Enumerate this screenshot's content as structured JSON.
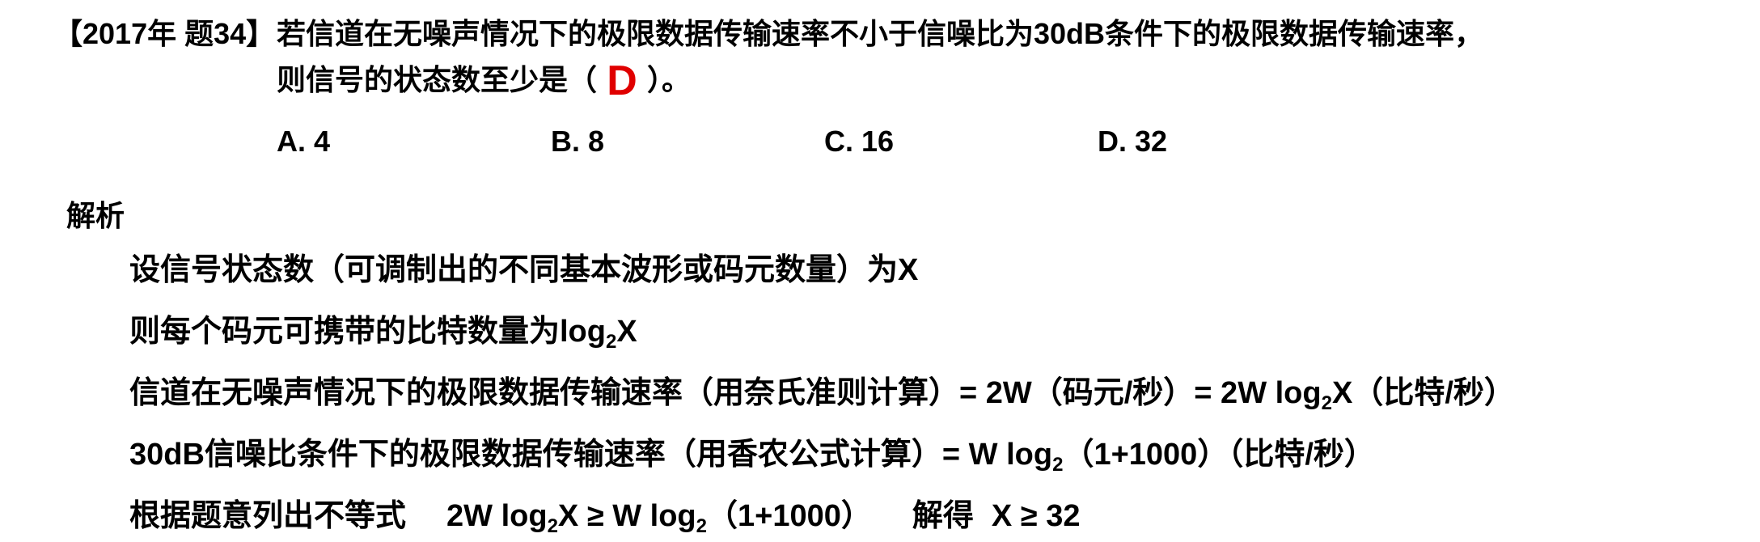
{
  "question": {
    "tag": "【2017年 题34】",
    "text_line1": "若信道在无噪声情况下的极限数据传输速率不小于信噪比为30dB条件下的极限数据传输速率，",
    "text_line2_before": "则信号的状态数至少是（",
    "answer": "D",
    "text_line2_after": "）。",
    "answer_color": "#e00000"
  },
  "options": [
    {
      "label": "A. 4"
    },
    {
      "label": "B. 8"
    },
    {
      "label": "C. 16"
    },
    {
      "label": "D. 32"
    }
  ],
  "analysis": {
    "title": "解析",
    "line1": "设信号状态数（可调制出的不同基本波形或码元数量）为X",
    "line2_pre": "则每个码元可携带的比特数量为log",
    "line2_sub": "2",
    "line2_post": "X",
    "line3_pre": "信道在无噪声情况下的极限数据传输速率（用奈氏准则计算）= 2W（码元/秒）= 2W log",
    "line3_sub": "2",
    "line3_post": "X（比特/秒）",
    "line4_pre": "30dB信噪比条件下的极限数据传输速率（用香农公式计算）= W log",
    "line4_sub": "2",
    "line4_post": "（1+1000）（比特/秒）",
    "line5_pre": "根据题意列出不等式",
    "line5_ineq_a": "2W log",
    "line5_ineq_sub1": "2",
    "line5_ineq_b": "X ≥ W log",
    "line5_ineq_sub2": "2",
    "line5_ineq_c": "（1+1000）",
    "line5_solve": "解得",
    "line5_result": "X ≥ 32"
  }
}
